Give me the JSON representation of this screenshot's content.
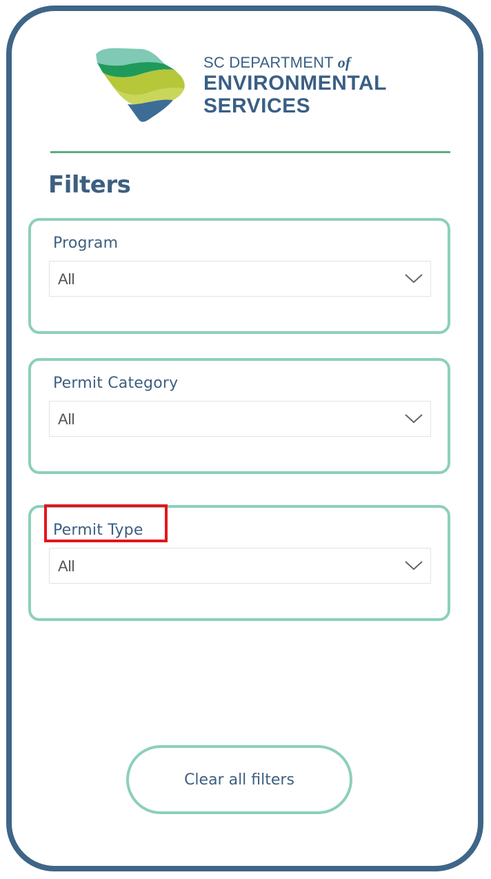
{
  "logo": {
    "line1_prefix": "SC DEPARTMENT ",
    "line1_of": "of",
    "line2": "ENVIRONMENTAL",
    "line3": "SERVICES",
    "colors": {
      "light_teal": "#7fc9b5",
      "green": "#1f9a5a",
      "lime": "#b6c73a",
      "blue": "#3d6d96"
    }
  },
  "page": {
    "title": "Filters"
  },
  "filters": [
    {
      "label": "Program",
      "value": "All"
    },
    {
      "label": "Permit Category",
      "value": "All"
    },
    {
      "label": "Permit Type",
      "value": "All"
    }
  ],
  "actions": {
    "clear_label": "Clear all filters"
  },
  "colors": {
    "frame_border": "#3f6587",
    "card_border": "#8ccfbd",
    "divider": "#5daa85",
    "text": "#3d5f80",
    "highlight": "#e5141d"
  }
}
